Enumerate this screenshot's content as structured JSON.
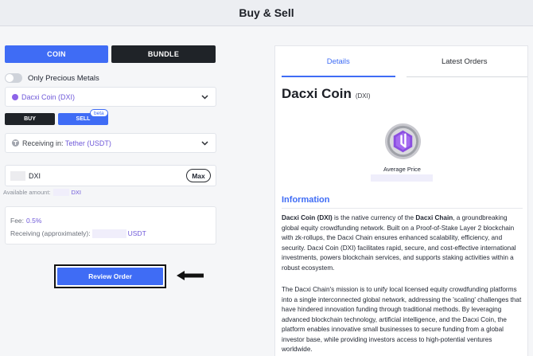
{
  "header": {
    "title": "Buy & Sell"
  },
  "mode_tabs": {
    "coin": "COIN",
    "bundle": "BUNDLE"
  },
  "filter": {
    "label": "Only Precious Metals",
    "enabled": false
  },
  "coin_select": {
    "value": "Dacxi Coin (DXI)"
  },
  "side": {
    "buy": "BUY",
    "sell": "SELL",
    "badge": "beta"
  },
  "receiving_select": {
    "prefix": "Receiving in:",
    "value": "Tether (USDT)"
  },
  "amount": {
    "unit": "DXI",
    "max_label": "Max"
  },
  "available": {
    "label": "Available amount:",
    "token": "DXI"
  },
  "fees": {
    "fee_label": "Fee:",
    "fee_value": "0.5%",
    "receiving_label": "Receiving (approximately):",
    "receiving_unit": "USDT"
  },
  "review_button": "Review Order",
  "details": {
    "tab_details": "Details",
    "tab_orders": "Latest Orders",
    "coin_name": "Dacxi Coin",
    "coin_symbol": "(DXI)",
    "avg_price_label": "Average Price",
    "info_heading": "Information",
    "p1_a": "Dacxi Coin (DXI)",
    "p1_b": " is the native currency of the ",
    "p1_c": "Dacxi Chain",
    "p1_d": ", a groundbreaking global equity crowdfunding network. Built on a Proof-of-Stake Layer 2 blockchain with zk-rollups, the Dacxi Chain ensures enhanced scalability, efficiency, and security. Dacxi Coin (DXI) facilitates rapid, secure, and cost-effective international investments, powers blockchain services, and supports staking activities within a robust ecosystem.",
    "p2": "The Dacxi Chain's mission is to unify local licensed equity crowdfunding platforms into a single interconnected global network, addressing the 'scaling' challenges that have hindered innovation funding through traditional methods. By leveraging advanced blockchain technology, artificial intelligence, and the Dacxi Coin, the platform enables innovative small businesses to secure funding from a global investor base, while providing investors access to high-potential ventures worldwide."
  },
  "colors": {
    "accent": "#3f6cf5",
    "coin_purple": "#6f59d9",
    "dark_button": "#1f2328"
  }
}
